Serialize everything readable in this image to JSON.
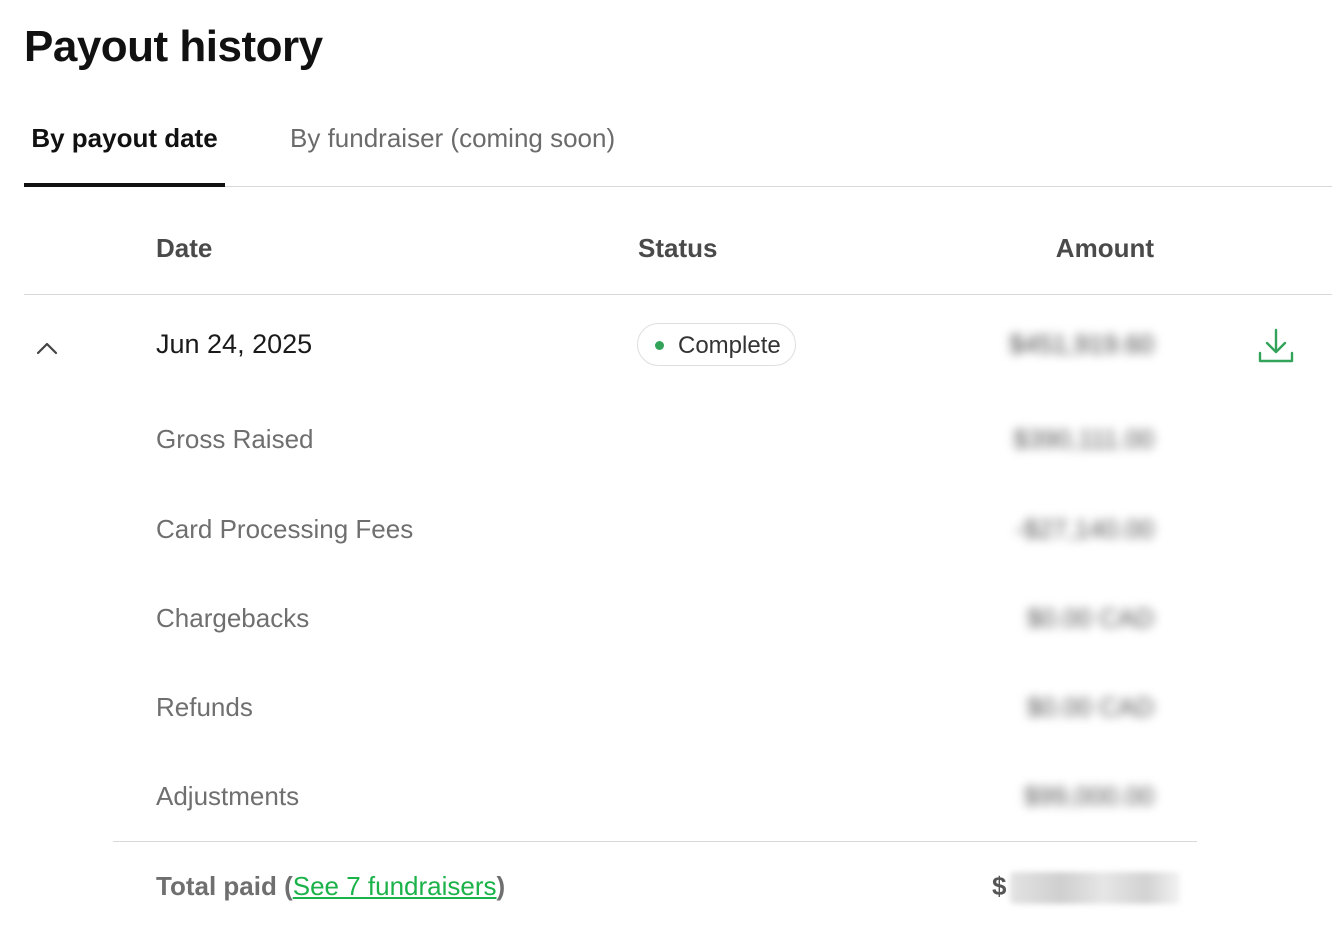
{
  "page": {
    "title": "Payout history"
  },
  "tabs": [
    {
      "label": "By payout date",
      "active": true
    },
    {
      "label": "By fundraiser (coming soon)",
      "active": false
    }
  ],
  "table": {
    "columns": {
      "date": "Date",
      "status": "Status",
      "amount": "Amount"
    },
    "payout": {
      "date": "Jun 24, 2025",
      "status": "Complete",
      "status_color": "#34a35a",
      "amount": "$451,919.60",
      "expanded": true,
      "toggle_icon": "chevron-up-icon",
      "download_icon": "download-icon",
      "download_color": "#34a35a"
    },
    "breakdown": [
      {
        "label": "Gross Raised",
        "amount": "$390,111.00"
      },
      {
        "label": "Card Processing Fees",
        "amount": "-$27,140.00"
      },
      {
        "label": "Chargebacks",
        "amount": "$0.00 CAD"
      },
      {
        "label": "Refunds",
        "amount": "$0.00 CAD"
      },
      {
        "label": "Adjustments",
        "amount": "$99,000.00"
      }
    ],
    "total": {
      "label_prefix": "Total paid (",
      "link_text": "See 7 fundraisers",
      "label_suffix": ")",
      "amount_prefix": "$",
      "link_color": "#1bb24a"
    }
  }
}
